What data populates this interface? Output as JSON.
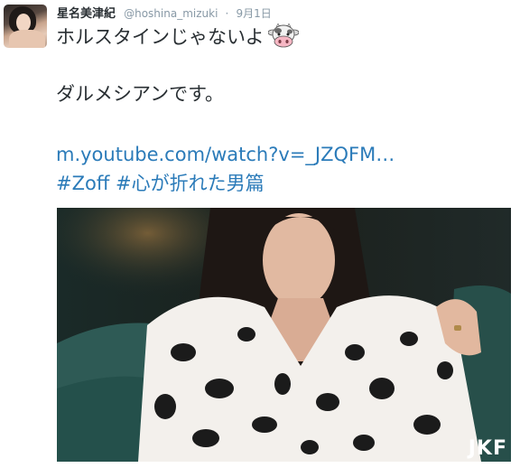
{
  "tweet": {
    "display_name": "星名美津紀",
    "handle": "@hoshina_mizuki",
    "separator": "·",
    "time": "9月1日",
    "line1": "ホルスタインじゃないよ",
    "line2": "ダルメシアンです。",
    "link": "m.youtube.com/watch?v=_JZQFM…",
    "hashtag1": "#Zoff",
    "hashtag2": "#心が折れた男篇"
  },
  "media": {
    "watermark": "JKF"
  },
  "icons": {
    "emoji": "cow-face-icon",
    "avatar": "avatar"
  },
  "colors": {
    "link": "#2b7bb9",
    "text": "#292f33",
    "muted": "#8899a6"
  }
}
